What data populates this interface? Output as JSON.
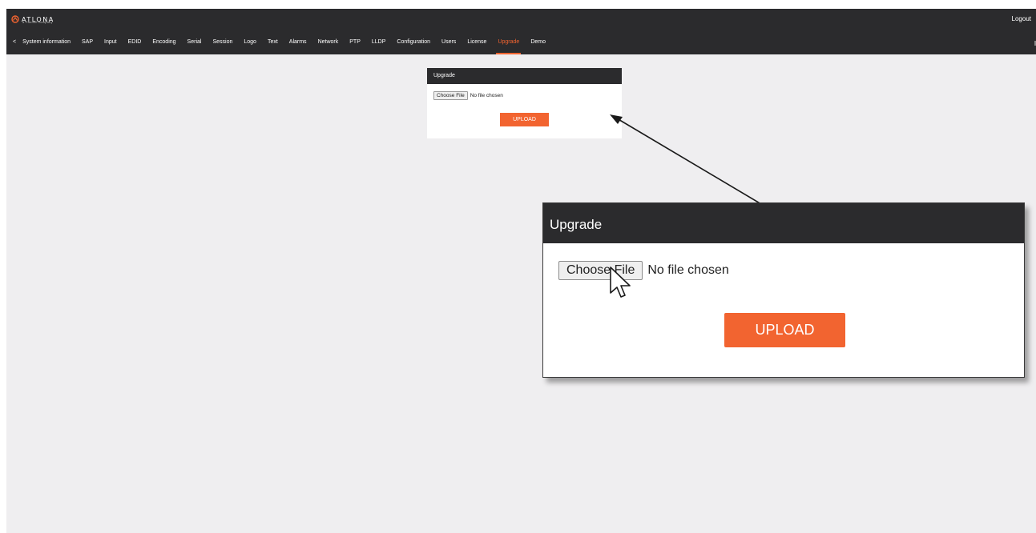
{
  "header": {
    "brand": "ATLONA",
    "brand_sub": "a Panduit company",
    "logout_label": "Logout"
  },
  "tabs": [
    {
      "label": "<"
    },
    {
      "label": "System information"
    },
    {
      "label": "SAP"
    },
    {
      "label": "Input"
    },
    {
      "label": "EDID"
    },
    {
      "label": "Encoding"
    },
    {
      "label": "Serial"
    },
    {
      "label": "Session"
    },
    {
      "label": "Logo"
    },
    {
      "label": "Text"
    },
    {
      "label": "Alarms"
    },
    {
      "label": "Network"
    },
    {
      "label": "PTP"
    },
    {
      "label": "LLDP"
    },
    {
      "label": "Configuration"
    },
    {
      "label": "Users"
    },
    {
      "label": "License"
    },
    {
      "label": "Upgrade",
      "active": true
    },
    {
      "label": "Demo"
    }
  ],
  "upgrade_panel": {
    "title": "Upgrade",
    "choose_file_label": "Choose File",
    "file_status": "No file chosen",
    "upload_label": "UPLOAD"
  },
  "callout": {
    "title": "Upgrade",
    "choose_file_label": "Choose File",
    "file_status": "No file chosen",
    "upload_label": "UPLOAD"
  },
  "colors": {
    "accent": "#f26430",
    "header_bg": "#2b2b2d",
    "page_bg": "#efeef0"
  },
  "icons": {
    "logo": "atlona-logo-icon",
    "cursor": "mouse-pointer-icon"
  }
}
